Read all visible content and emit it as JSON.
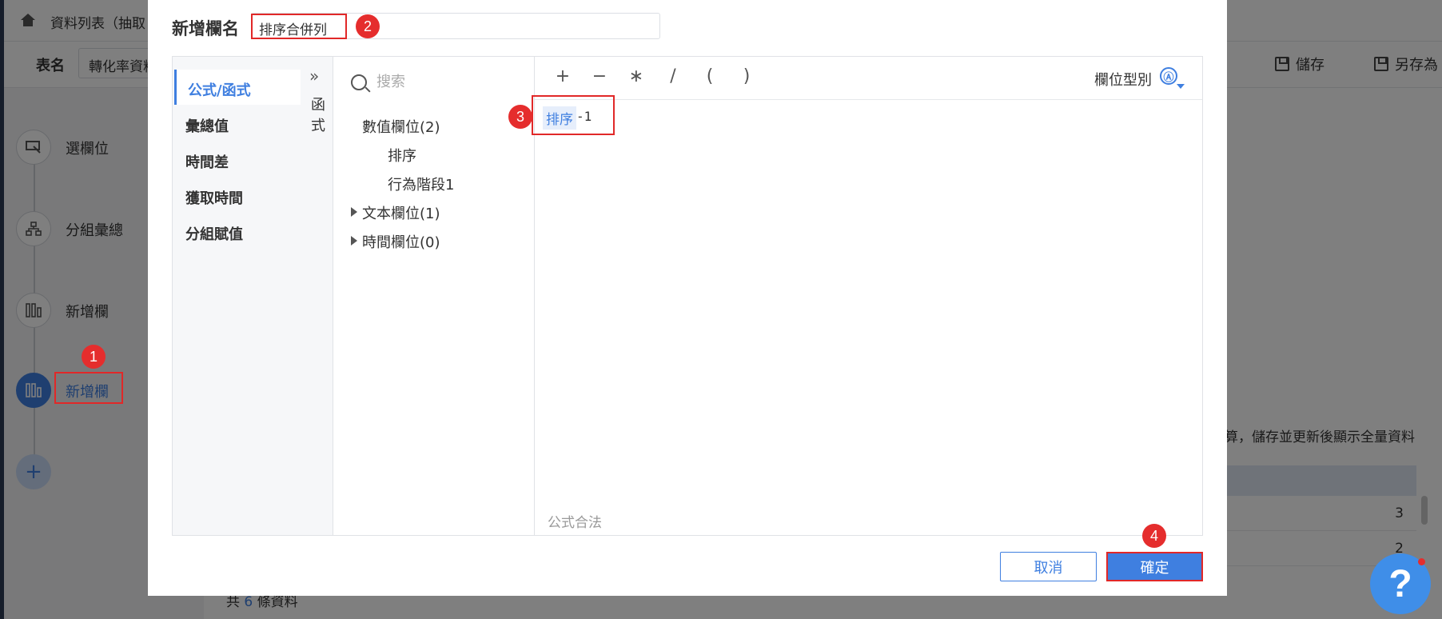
{
  "background": {
    "tab_title": "資料列表（抽取",
    "table_label": "表名",
    "table_input": "轉化率資料",
    "save_button": "儲存",
    "save_as_button": "另存為",
    "flow_nodes": [
      {
        "label": "選欄位"
      },
      {
        "label": "分組彙總"
      },
      {
        "label": "新增欄"
      },
      {
        "label": "新增欄"
      }
    ],
    "notice": "算，儲存並更新後顯示全量資料",
    "table_rows": [
      "3",
      "2"
    ],
    "footer_prefix": "共",
    "footer_count": "6",
    "footer_suffix": "條資料"
  },
  "modal": {
    "title": "新增欄名",
    "name_value": "排序合併列",
    "categories": [
      "公式/函式",
      "彙總值",
      "時間差",
      "獲取時間",
      "分組賦值"
    ],
    "collapse_label": "函式",
    "search_placeholder": "搜索",
    "tree": {
      "numeric_group": "數值欄位(2)",
      "numeric_items": [
        "排序",
        "行為階段1"
      ],
      "text_group": "文本欄位(1)",
      "time_group": "時間欄位(0)"
    },
    "operators": [
      "+",
      "−",
      "∗",
      "/",
      "(",
      ")"
    ],
    "field_type_label": "欄位型別",
    "field_type_icon": "Ⓐ",
    "formula_field": "排序",
    "formula_text": "-1",
    "formula_status": "公式合法",
    "cancel_label": "取消",
    "ok_label": "確定"
  },
  "badges": [
    "1",
    "2",
    "3",
    "4"
  ],
  "help_label": "?"
}
